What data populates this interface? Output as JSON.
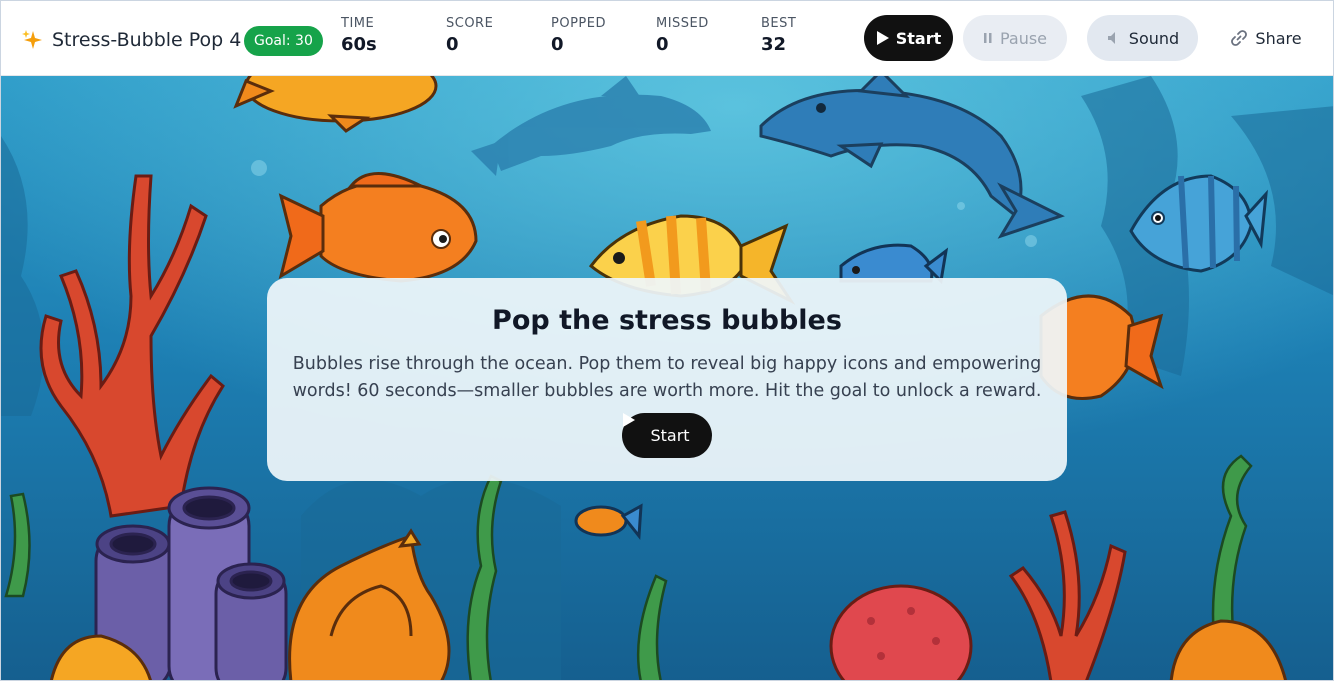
{
  "header": {
    "title": "Stress-Bubble Pop 4",
    "brand_icon": "sparkles-icon",
    "goal_badge": "Goal: 30",
    "stats": [
      {
        "label": "TIME",
        "value": "60s"
      },
      {
        "label": "SCORE",
        "value": "0"
      },
      {
        "label": "POPPED",
        "value": "0"
      },
      {
        "label": "MISSED",
        "value": "0"
      },
      {
        "label": "BEST",
        "value": "32"
      }
    ],
    "buttons": {
      "start": "Start",
      "pause": "Pause",
      "sound": "Sound",
      "share": "Share"
    }
  },
  "overlay": {
    "title": "Pop the stress bubbles",
    "body": "Bubbles rise through the ocean. Pop them to reveal big happy icons and empowering words! 60 seconds—smaller bubbles are worth more. Hit the goal to unlock a reward.",
    "start_label": "Start"
  },
  "colors": {
    "goal_badge": "#16a34a",
    "start_button": "#111111",
    "ocean": "#1f7fb0"
  },
  "scene": {
    "background": "underwater-ocean-scene",
    "elements": [
      "dolphin",
      "orange-fish",
      "striped-fish",
      "blue-fish",
      "coral",
      "seashell",
      "sponge-tubes",
      "seaweed"
    ]
  }
}
